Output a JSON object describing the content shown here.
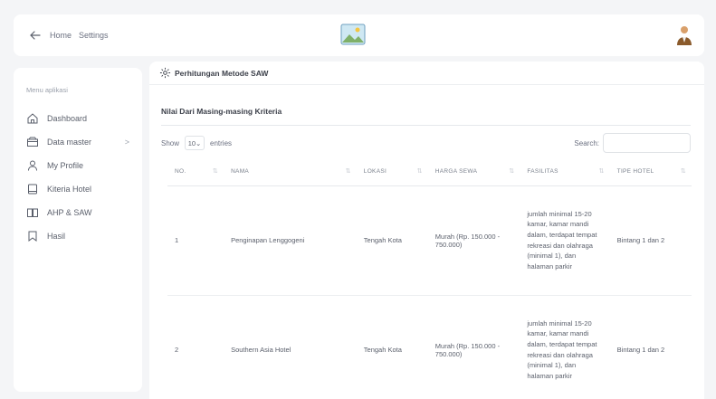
{
  "topbar": {
    "breadcrumb": [
      "Home",
      "Settings"
    ]
  },
  "sidebar": {
    "title": "Menu aplikasi",
    "items": [
      {
        "label": "Dashboard",
        "icon": "home-icon"
      },
      {
        "label": "Data master",
        "icon": "folder-icon",
        "chevron": ">"
      },
      {
        "label": "My Profile",
        "icon": "user-icon"
      },
      {
        "label": "Kiteria Hotel",
        "icon": "square-icon"
      },
      {
        "label": "AHP & SAW",
        "icon": "book-icon"
      },
      {
        "label": "Hasil",
        "icon": "bookmark-icon"
      }
    ]
  },
  "card": {
    "title": "Perhitungan Metode SAW",
    "section_title": "Nilai Dari Masing-masing Kriteria"
  },
  "controls": {
    "show_label": "Show",
    "entries_value": "10",
    "entries_label": "entries",
    "search_label": "Search:"
  },
  "table": {
    "headers": [
      "NO.",
      "NAMA",
      "LOKASI",
      "HARGA SEWA",
      "FASILITAS",
      "TIPE HOTEL"
    ],
    "rows": [
      {
        "no": "1",
        "nama": "Penginapan Lenggogeni",
        "lokasi": "Tengah Kota",
        "harga": "Murah (Rp. 150.000 - 750.000)",
        "fasilitas": "jumlah minimal 15-20 kamar, kamar mandi dalam, terdapat tempat rekreasi dan olahraga (minimal 1), dan halaman parkir",
        "tipe": "Bintang 1 dan 2"
      },
      {
        "no": "2",
        "nama": "Southern Asia Hotel",
        "lokasi": "Tengah Kota",
        "harga": "Murah (Rp. 150.000 - 750.000)",
        "fasilitas": "jumlah minimal 15-20 kamar, kamar mandi dalam, terdapat tempat rekreasi dan olahraga (minimal 1), dan halaman parkir",
        "tipe": "Bintang 1 dan 2"
      }
    ]
  },
  "colors": {
    "background": "#f4f5f7",
    "card": "#ffffff",
    "text": "#5a5f6b"
  }
}
